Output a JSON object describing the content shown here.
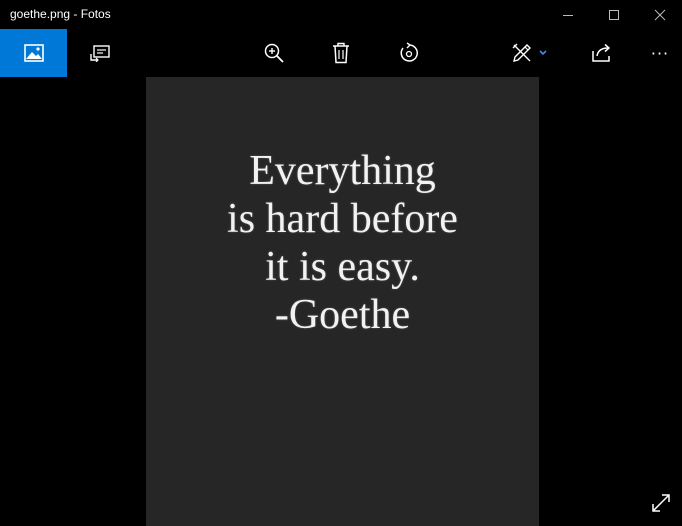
{
  "window": {
    "title": "goethe.png - Fotos"
  },
  "toolbar": {
    "collection_icon": "image-icon",
    "slideshow_icon": "slideshow-icon",
    "zoom_icon": "zoom-in-icon",
    "delete_icon": "delete-icon",
    "rotate_icon": "rotate-icon",
    "edit_icon": "edit-create-icon",
    "share_icon": "share-icon",
    "more_label": "···",
    "accent_color": "#0078d7"
  },
  "photo": {
    "lines": [
      "Everything",
      "is hard before",
      "it is easy.",
      "-Goethe"
    ],
    "background_color": "#262626"
  }
}
